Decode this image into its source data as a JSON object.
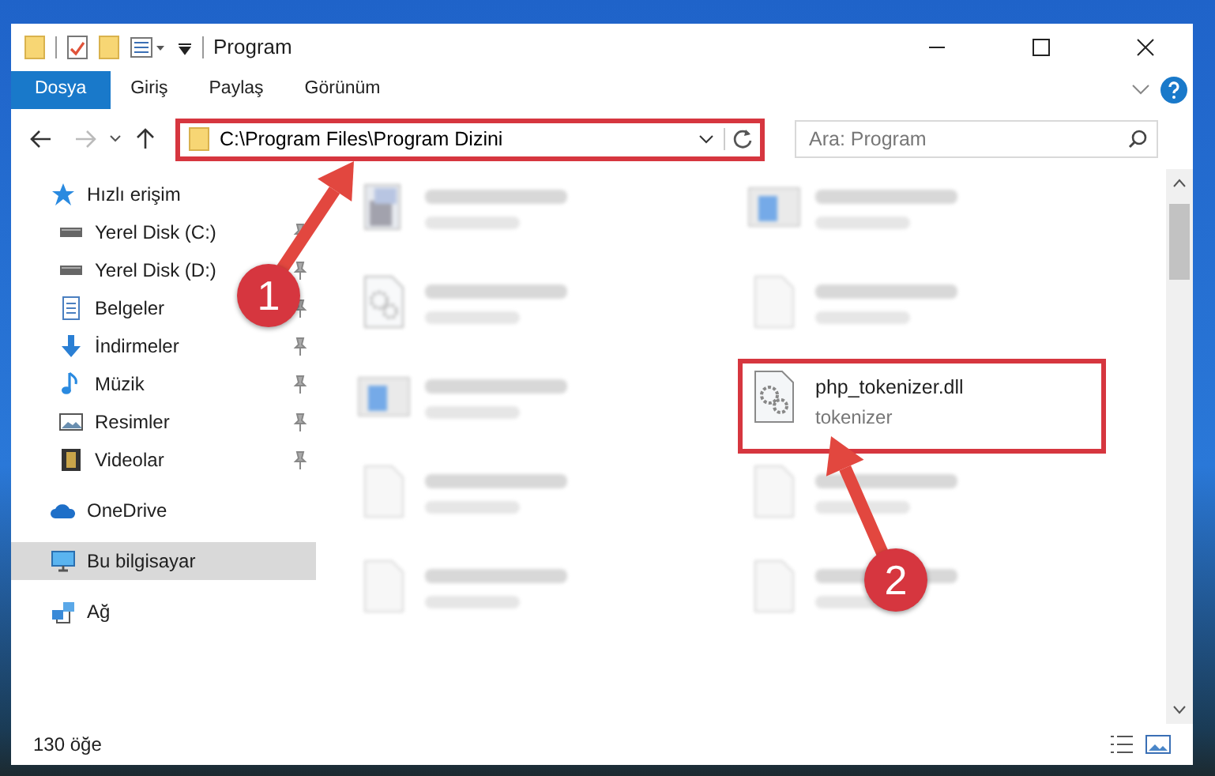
{
  "window": {
    "title": "Program"
  },
  "ribbon_tabs": [
    {
      "label": "Dosya",
      "selected": true
    },
    {
      "label": "Giriş",
      "selected": false
    },
    {
      "label": "Paylaş",
      "selected": false
    },
    {
      "label": "Görünüm",
      "selected": false
    }
  ],
  "address_bar": {
    "path": "C:\\Program Files\\Program Dizini",
    "highlighted": true
  },
  "search": {
    "placeholder": "Ara: Program"
  },
  "sidebar": {
    "items": [
      {
        "label": "Hızlı erişim",
        "kind": "star",
        "pinned": false,
        "selected": false
      },
      {
        "label": "Yerel Disk (C:)",
        "kind": "drive",
        "pinned": true,
        "selected": false
      },
      {
        "label": "Yerel Disk (D:)",
        "kind": "drive",
        "pinned": true,
        "selected": false
      },
      {
        "label": "Belgeler",
        "kind": "document",
        "pinned": true,
        "selected": false
      },
      {
        "label": "İndirmeler",
        "kind": "download",
        "pinned": true,
        "selected": false
      },
      {
        "label": "Müzik",
        "kind": "music",
        "pinned": true,
        "selected": false
      },
      {
        "label": "Resimler",
        "kind": "pictures",
        "pinned": true,
        "selected": false
      },
      {
        "label": "Videolar",
        "kind": "video",
        "pinned": true,
        "selected": false
      },
      {
        "label": "OneDrive",
        "kind": "cloud",
        "pinned": false,
        "selected": false
      },
      {
        "label": "Bu bilgisayar",
        "kind": "computer",
        "pinned": false,
        "selected": true
      },
      {
        "label": "Ağ",
        "kind": "network",
        "pinned": false,
        "selected": false
      }
    ]
  },
  "files": [
    {
      "kind": "installer",
      "blurred": true
    },
    {
      "kind": "app",
      "blurred": true
    },
    {
      "kind": "dll",
      "blurred": true
    },
    {
      "kind": "text",
      "blurred": true
    },
    {
      "kind": "app",
      "blurred": true
    },
    {
      "name": "php_tokenizer.dll",
      "type": "tokenizer",
      "kind": "dll",
      "blurred": false,
      "highlighted": true
    },
    {
      "kind": "text",
      "blurred": true
    },
    {
      "kind": "text",
      "blurred": true
    },
    {
      "kind": "text",
      "blurred": true
    },
    {
      "kind": "text",
      "blurred": true
    }
  ],
  "status_bar": {
    "item_count": "130 öğe"
  },
  "annotations": [
    {
      "label": "1"
    },
    {
      "label": "2"
    }
  ]
}
